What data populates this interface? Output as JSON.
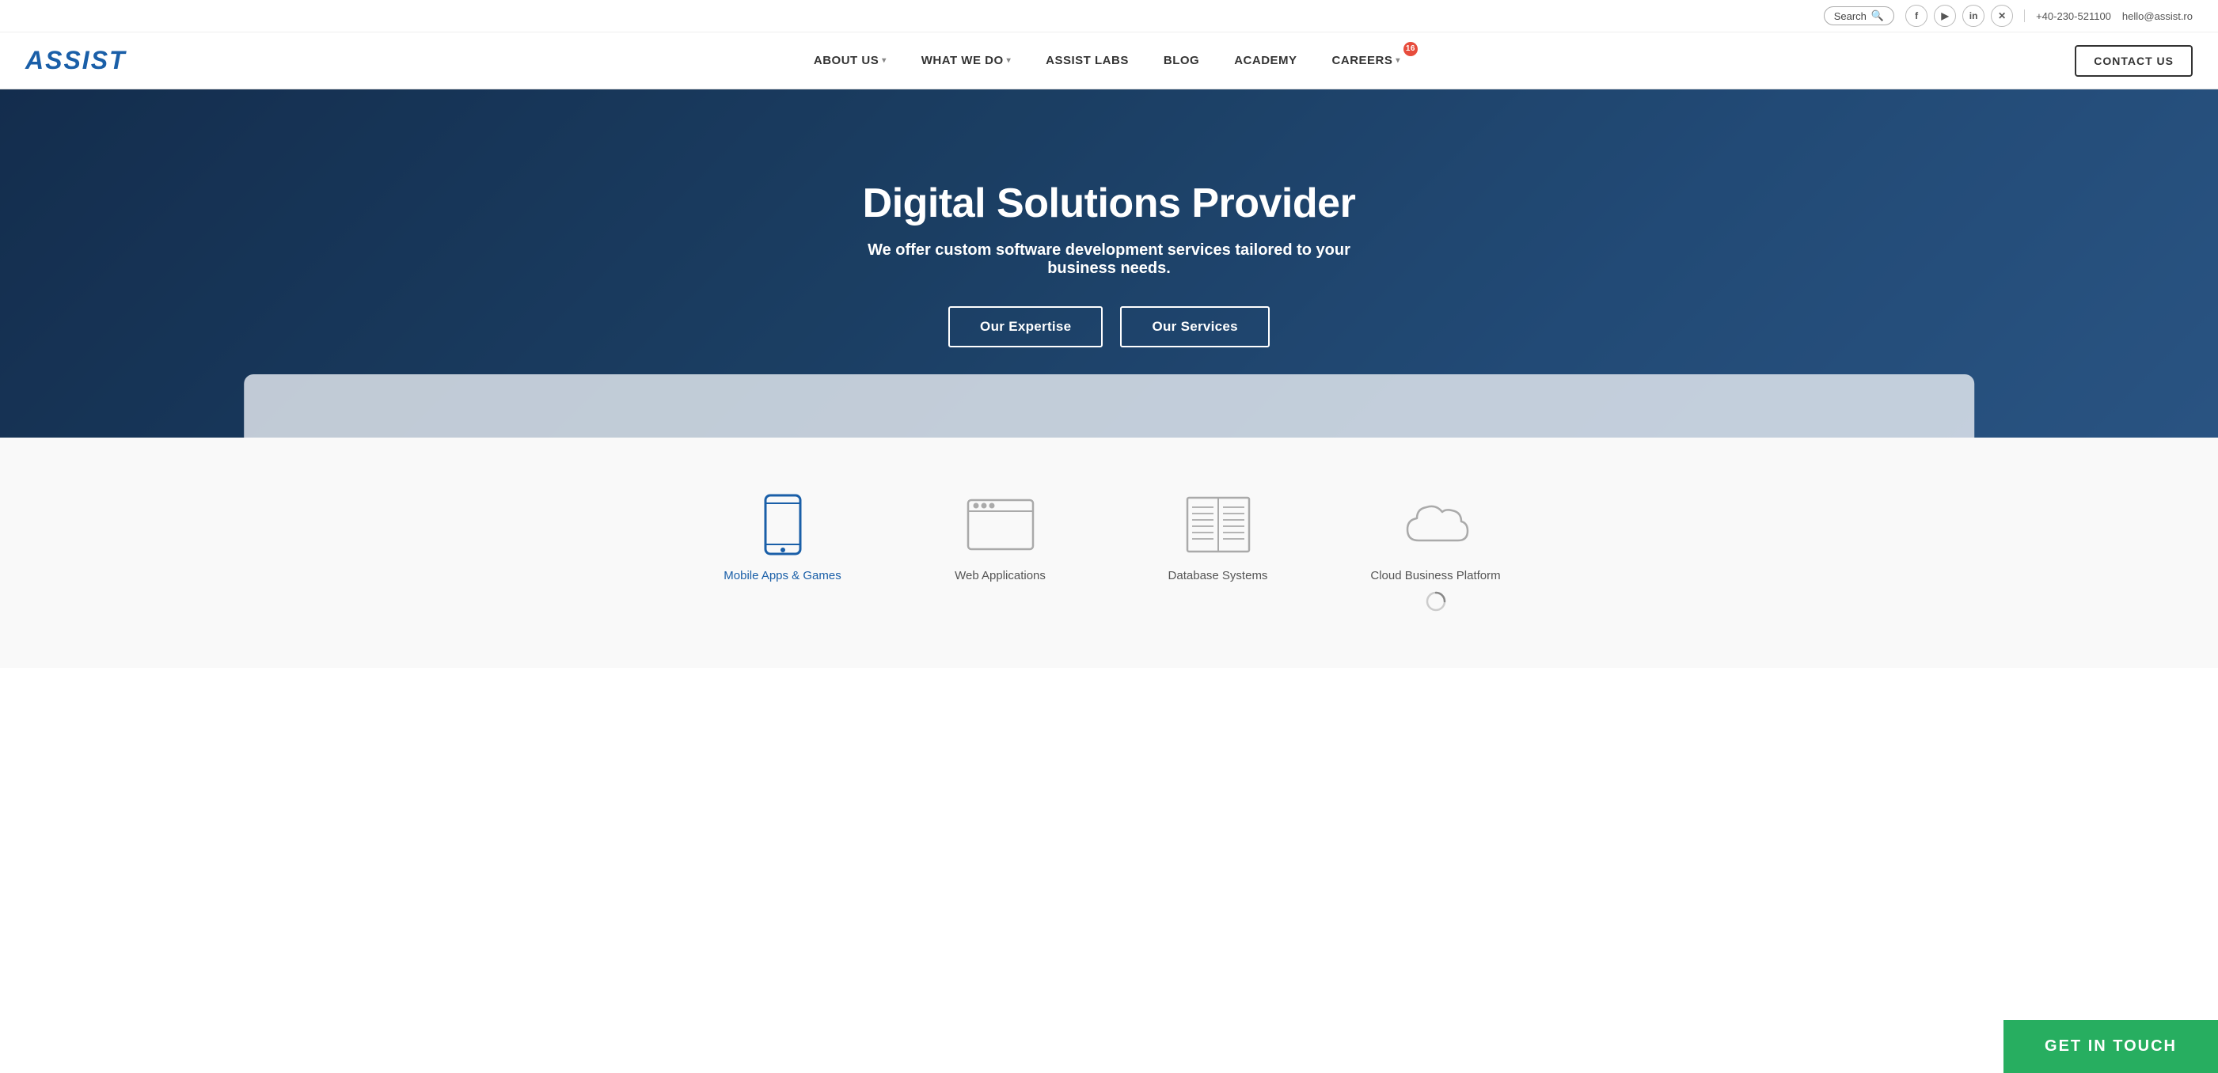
{
  "topbar": {
    "search_label": "Search",
    "phone": "+40-230-521100",
    "email": "hello@assist.ro",
    "social": [
      {
        "name": "facebook",
        "symbol": "f"
      },
      {
        "name": "youtube",
        "symbol": "▶"
      },
      {
        "name": "linkedin",
        "symbol": "in"
      },
      {
        "name": "xing",
        "symbol": "X"
      }
    ]
  },
  "nav": {
    "logo": "ASSIST",
    "items": [
      {
        "label": "ABOUT US",
        "has_arrow": true
      },
      {
        "label": "WHAT WE DO",
        "has_arrow": true
      },
      {
        "label": "ASSIST LABS",
        "has_arrow": false
      },
      {
        "label": "BLOG",
        "has_arrow": false
      },
      {
        "label": "ACADEMY",
        "has_arrow": false
      },
      {
        "label": "CAREERS",
        "has_arrow": true,
        "badge": "16"
      }
    ],
    "contact_btn": "CONTACT US"
  },
  "hero": {
    "title": "Digital Solutions Provider",
    "subtitle": "We offer custom software development services tailored to your business needs.",
    "btn_expertise": "Our Expertise",
    "btn_services": "Our Services"
  },
  "services": {
    "heading": "Our Services",
    "items": [
      {
        "label": "Mobile Apps & Games",
        "active": true,
        "icon": "mobile"
      },
      {
        "label": "Web Applications",
        "active": false,
        "icon": "web"
      },
      {
        "label": "Database Systems",
        "active": false,
        "icon": "database"
      },
      {
        "label": "Cloud Business Platform",
        "active": false,
        "icon": "cloud"
      }
    ]
  },
  "get_in_touch": "GET IN TOUCH"
}
